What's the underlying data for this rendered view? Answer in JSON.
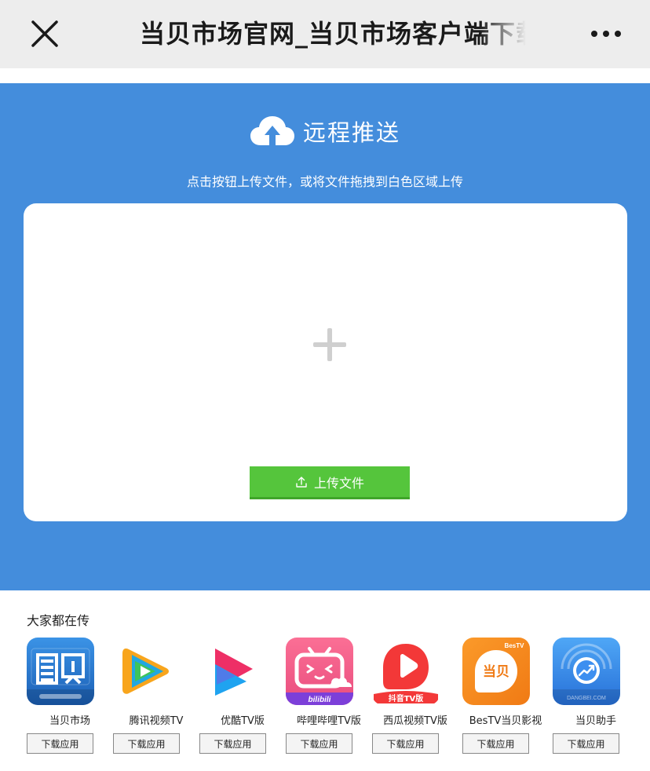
{
  "navbar": {
    "title": "当贝市场官网_当贝市场客户端下载",
    "close_icon": "close-icon",
    "more_icon": "more-dots-icon"
  },
  "upload": {
    "header_title": "远程推送",
    "header_icon": "cloud-upload-icon",
    "hint": "点击按钮上传文件，或将文件拖拽到白色区域上传",
    "add_icon": "plus-icon",
    "button_label": "上传文件",
    "button_icon": "upload-icon"
  },
  "popular": {
    "title": "大家都在传",
    "download_label": "下载应用",
    "apps": [
      {
        "name": "当贝市场",
        "icon": "dangbei-market-icon"
      },
      {
        "name": "腾讯视频TV",
        "icon": "tencent-video-icon"
      },
      {
        "name": "优酷TV版",
        "icon": "youku-icon"
      },
      {
        "name": "哔哩哔哩TV版",
        "icon": "bilibili-icon",
        "icon_text": "bilibili"
      },
      {
        "name": "西瓜视频TV版",
        "icon": "xigua-video-icon",
        "icon_text": "抖音TV版"
      },
      {
        "name": "BesTV当贝影视",
        "icon": "bestv-icon",
        "icon_text": "当贝",
        "icon_badge": "BesTV"
      },
      {
        "name": "当贝助手",
        "icon": "dangbei-assistant-icon",
        "icon_text": "DANGBEI.COM"
      }
    ]
  },
  "colors": {
    "navbar_bg": "#ededed",
    "blue_bg": "#448ddc",
    "upload_button": "#55c53c"
  }
}
